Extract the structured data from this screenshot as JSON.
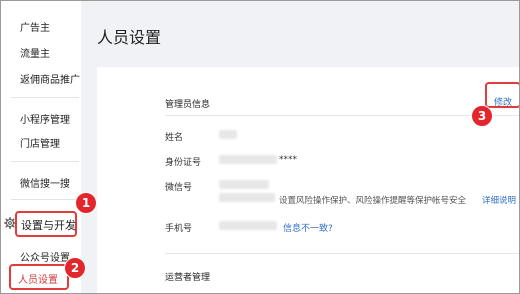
{
  "sidebar": {
    "items_top": [
      "广告主",
      "流量主",
      "返佣商品推广"
    ],
    "items_mid": [
      "小程序管理",
      "门店管理"
    ],
    "search": "微信搜一搜",
    "settings_group": "设置与开发",
    "sub_items": [
      "公众号设置",
      "人员设置"
    ]
  },
  "page": {
    "title": "人员设置"
  },
  "admin_info": {
    "title": "管理员信息",
    "modify": "修改",
    "rows": {
      "name_label": "姓名",
      "id_label": "身份证号",
      "id_suffix": "****",
      "wechat_label": "微信号",
      "wechat_note": "设置风险操作保护、风险操作提醒等保护帐号安全",
      "wechat_link": "详细说明",
      "phone_label": "手机号",
      "phone_link": "信息不一致?"
    }
  },
  "operators": {
    "title": "运营者管理"
  },
  "annotations": {
    "badge1": "1",
    "badge2": "2",
    "badge3": "3"
  },
  "colors": {
    "highlight": "#e23b3b",
    "link": "#2f6fc4",
    "badge": "#e3262c"
  }
}
